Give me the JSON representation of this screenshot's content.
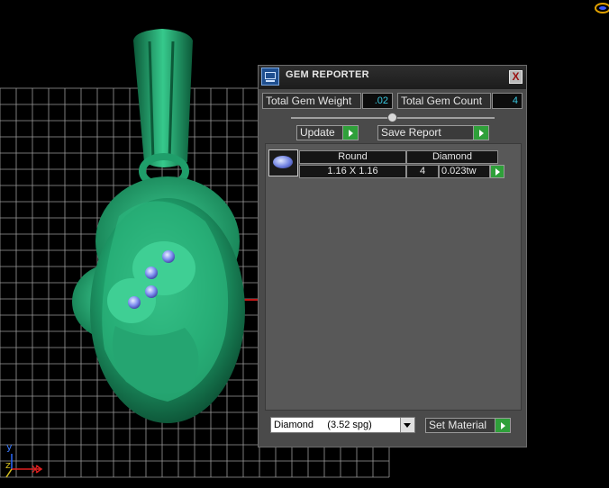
{
  "panel": {
    "title": "GEM REPORTER",
    "close_label": "X",
    "total_gem_weight_label": "Total Gem Weight",
    "total_gem_weight_value": ".02",
    "total_gem_count_label": "Total Gem Count",
    "total_gem_count_value": "4",
    "update_label": "Update",
    "save_report_label": "Save Report"
  },
  "gems": {
    "columns": [
      "Round",
      "Diamond"
    ],
    "rows": [
      {
        "size": "1.16 X 1.16",
        "count": "4",
        "weight": "0.023tw"
      }
    ]
  },
  "material": {
    "selected": "Diamond     (3.52 spg)",
    "set_material_label": "Set Material"
  },
  "axes": {
    "y": "y",
    "z": "z"
  },
  "colors": {
    "model": "#1f9e6a",
    "grid": "#9a9a9a",
    "accent_green": "#2fa03a",
    "value_cyan": "#39c8e0"
  }
}
